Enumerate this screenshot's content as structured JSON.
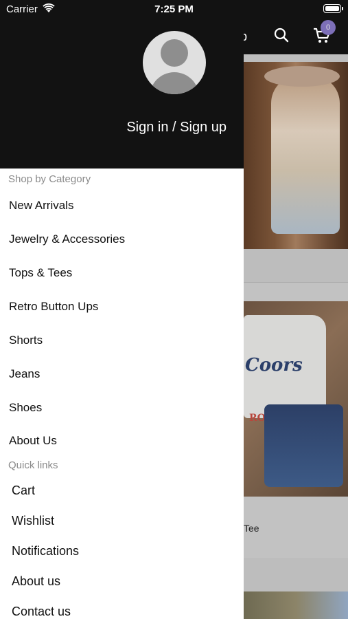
{
  "status_bar": {
    "carrier": "Carrier",
    "time": "7:25 PM"
  },
  "background": {
    "cart_badge": "0",
    "partial_label": "Tee",
    "partial_header_char": "p",
    "tee_text": "Coors",
    "tee_text2": "RODEO"
  },
  "drawer": {
    "signin": "Sign in / Sign up",
    "shop_section": "Shop by Category",
    "categories": [
      "New Arrivals",
      "Jewelry & Accessories",
      "Tops & Tees",
      "Retro Button Ups",
      "Shorts",
      "Jeans",
      "Shoes",
      "About Us"
    ],
    "quick_section": "Quick links",
    "quick_links": [
      "Cart",
      "Wishlist",
      "Notifications",
      "About us",
      "Contact us"
    ]
  }
}
